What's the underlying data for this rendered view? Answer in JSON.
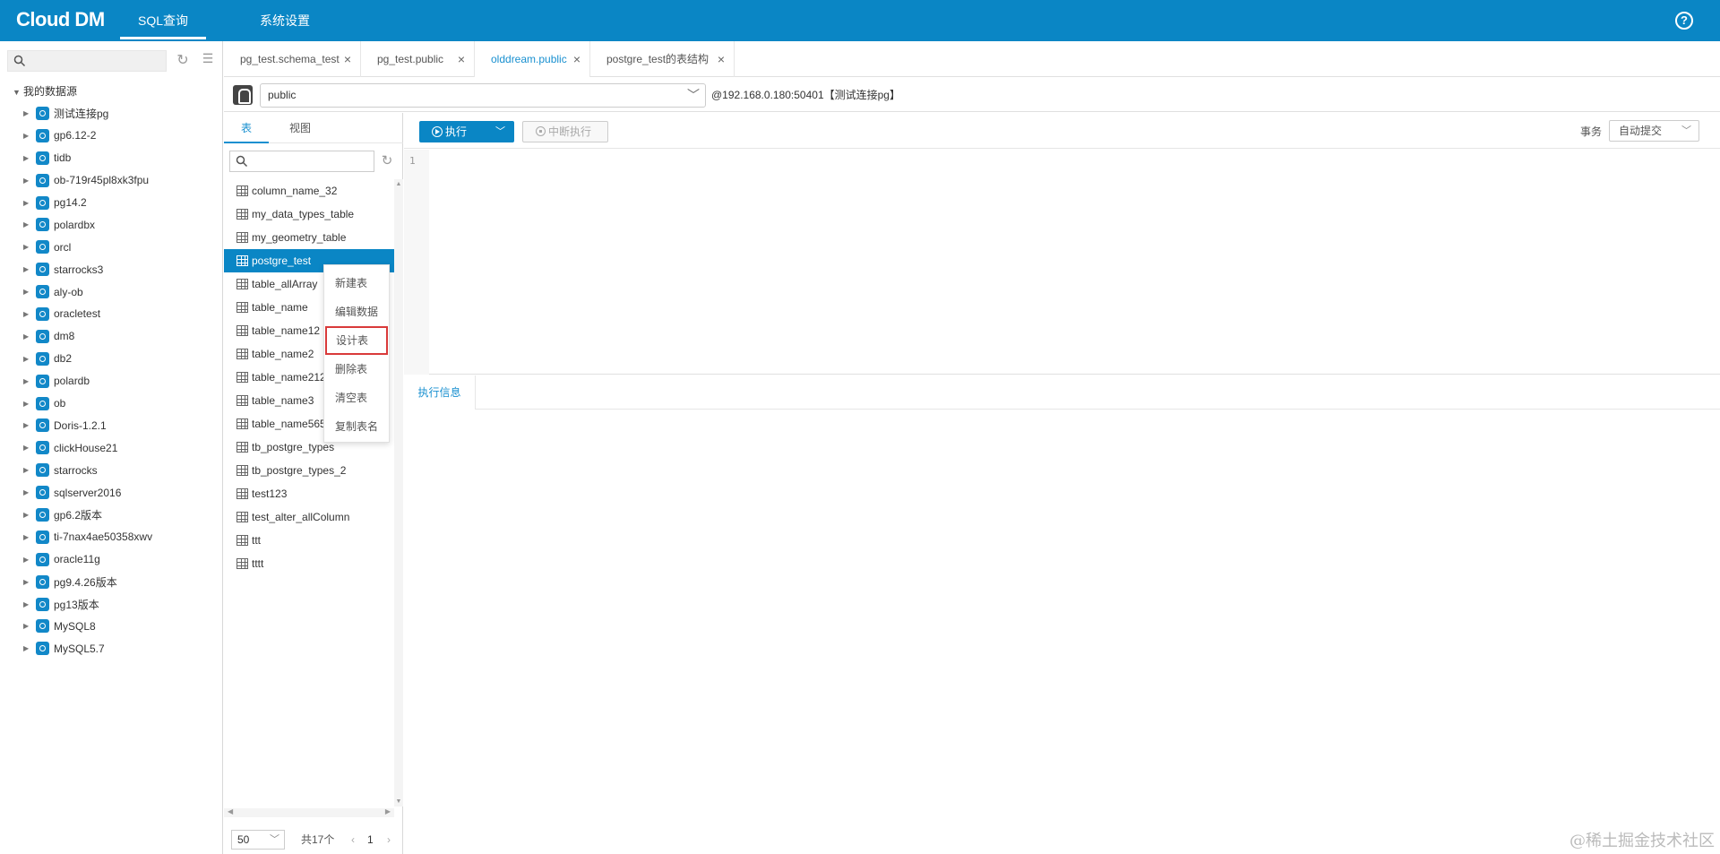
{
  "brand": {
    "logo": "Cloud DM",
    "accent": "#0a86c5",
    "highlight": "#d93a3a"
  },
  "nav": {
    "sql_query": "SQL查询",
    "system_settings": "系统设置"
  },
  "left": {
    "search_placeholder": "",
    "root_label": "我的数据源",
    "datasources": [
      "测试连接pg",
      "gp6.12-2",
      "tidb",
      "ob-719r45pl8xk3fpu",
      "pg14.2",
      "polardbx",
      "orcl",
      "starrocks3",
      "aly-ob",
      "oracletest",
      "dm8",
      "db2",
      "polardb",
      "ob",
      "Doris-1.2.1",
      "clickHouse21",
      "starrocks",
      "sqlserver2016",
      "gp6.2版本",
      "ti-7nax4ae50358xwv",
      "oracle11g",
      "pg9.4.26版本",
      "pg13版本",
      "MySQL8",
      "MySQL5.7"
    ]
  },
  "tabs": [
    {
      "label": "pg_test.schema_test"
    },
    {
      "label": "pg_test.public"
    },
    {
      "label": "olddream.public"
    },
    {
      "label": "postgre_test的表结构"
    }
  ],
  "schema": {
    "selected": "public",
    "connection": "@192.168.0.180:50401【测试连接pg】"
  },
  "tables_panel": {
    "tab_tables": "表",
    "tab_views": "视图",
    "items": [
      "column_name_32",
      "my_data_types_table",
      "my_geometry_table",
      "postgre_test",
      "table_allArray",
      "table_name",
      "table_name12",
      "table_name2",
      "table_name212",
      "table_name3",
      "table_name565",
      "tb_postgre_types",
      "tb_postgre_types_2",
      "test123",
      "test_alter_allColumn",
      "ttt",
      "tttt"
    ],
    "page_size": "50",
    "total": "共17个",
    "page": "1"
  },
  "context_menu": [
    "新建表",
    "编辑数据",
    "设计表",
    "删除表",
    "清空表",
    "复制表名"
  ],
  "toolbar": {
    "run": "执行",
    "stop": "中断执行",
    "transaction_label": "事务",
    "transaction_mode": "自动提交"
  },
  "editor": {
    "line_number": "1"
  },
  "result": {
    "tab_label": "执行信息"
  },
  "watermark": "@稀土掘金技术社区"
}
